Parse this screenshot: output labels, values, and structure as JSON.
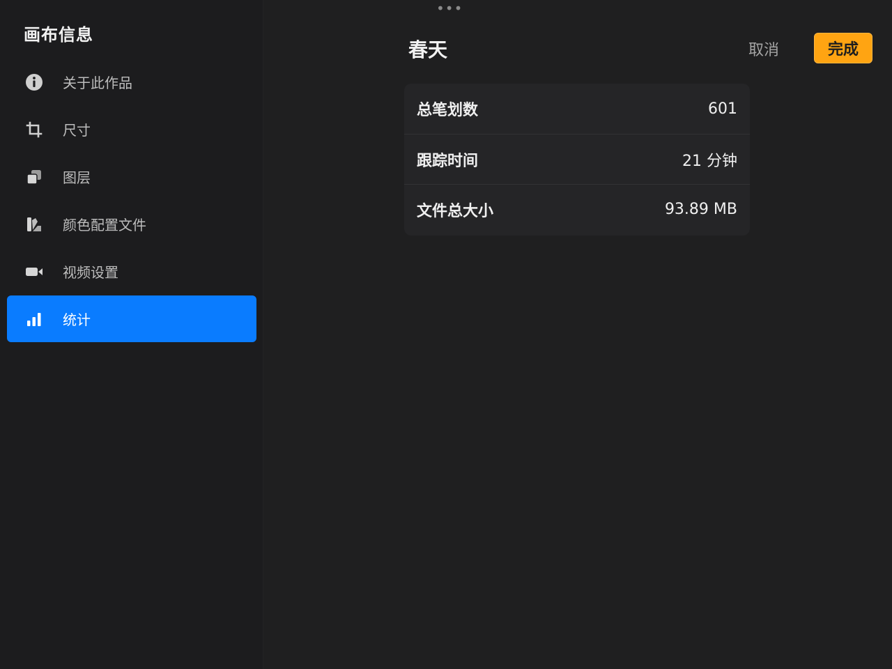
{
  "sidebar": {
    "title": "画布信息",
    "items": [
      {
        "label": "关于此作品",
        "icon": "info-icon",
        "active": false
      },
      {
        "label": "尺寸",
        "icon": "crop-icon",
        "active": false
      },
      {
        "label": "图层",
        "icon": "layers-icon",
        "active": false
      },
      {
        "label": "颜色配置文件",
        "icon": "color-profile-icon",
        "active": false
      },
      {
        "label": "视频设置",
        "icon": "video-camera-icon",
        "active": false
      },
      {
        "label": "统计",
        "icon": "bar-chart-icon",
        "active": true
      }
    ]
  },
  "header": {
    "grabber": "•••",
    "title": "春天",
    "cancel_label": "取消",
    "done_label": "完成"
  },
  "stats": [
    {
      "label": "总笔划数",
      "value": "601"
    },
    {
      "label": "跟踪时间",
      "value": "21 分钟"
    },
    {
      "label": "文件总大小",
      "value": "93.89 MB"
    }
  ],
  "colors": {
    "accent_active": "#0a7cff",
    "done_button": "#ffa412",
    "background": "#1c1c1e",
    "card": "#252527"
  }
}
